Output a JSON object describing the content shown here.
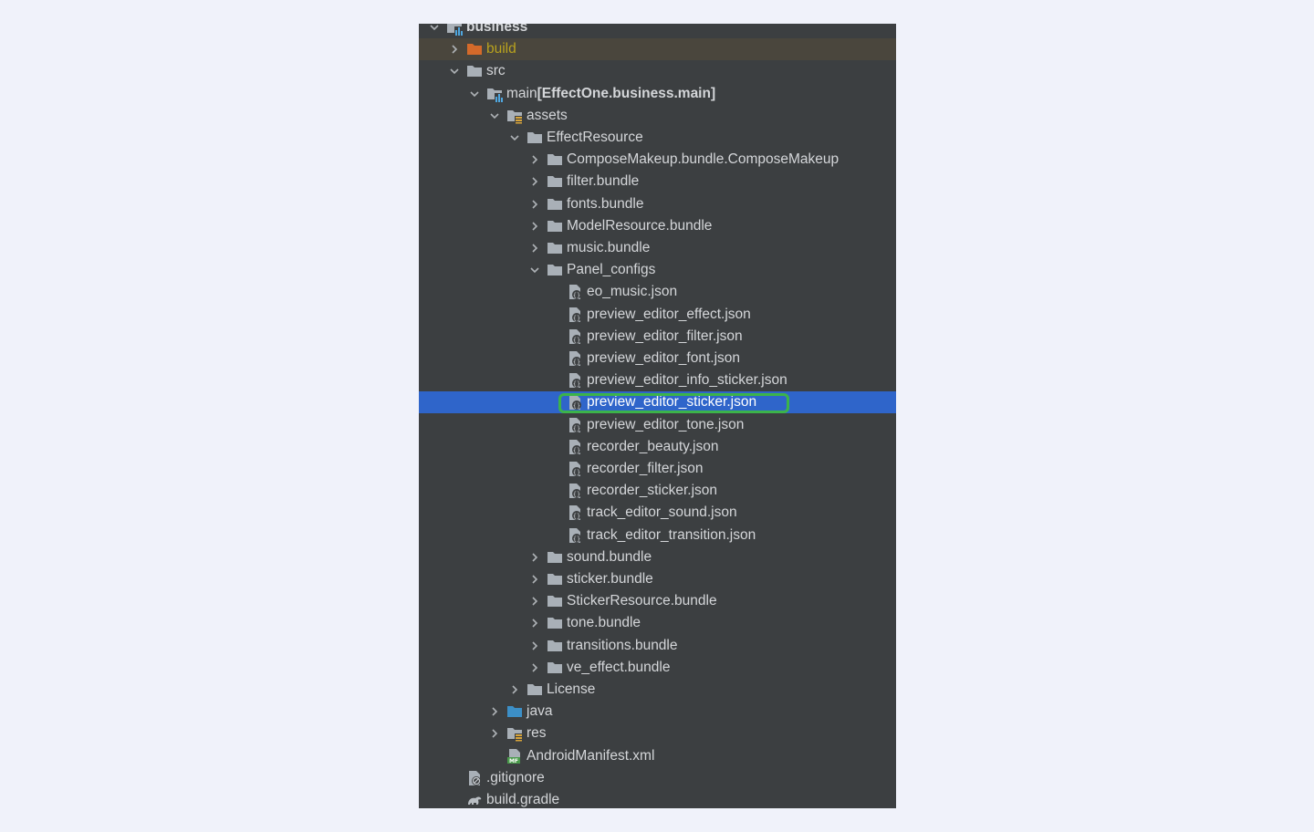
{
  "tree": {
    "nodes": [
      {
        "label": "business",
        "depth": 0,
        "expanded": true,
        "icon": "module-icon",
        "bold": true
      },
      {
        "label": "build",
        "depth": 1,
        "expanded": false,
        "icon": "folder-orange-icon",
        "style": "build"
      },
      {
        "label": "src",
        "depth": 1,
        "expanded": true,
        "icon": "folder-icon"
      },
      {
        "label": "main",
        "suffix": " [EffectOne.business.main]",
        "depth": 2,
        "expanded": true,
        "icon": "module-icon"
      },
      {
        "label": "assets",
        "depth": 3,
        "expanded": true,
        "icon": "resources-folder-icon"
      },
      {
        "label": "EffectResource",
        "depth": 4,
        "expanded": true,
        "icon": "folder-icon"
      },
      {
        "label": "ComposeMakeup.bundle.ComposeMakeup",
        "depth": 5,
        "expanded": false,
        "icon": "folder-icon"
      },
      {
        "label": "filter.bundle",
        "depth": 5,
        "expanded": false,
        "icon": "folder-icon"
      },
      {
        "label": "fonts.bundle",
        "depth": 5,
        "expanded": false,
        "icon": "folder-icon"
      },
      {
        "label": "ModelResource.bundle",
        "depth": 5,
        "expanded": false,
        "icon": "folder-icon"
      },
      {
        "label": "music.bundle",
        "depth": 5,
        "expanded": false,
        "icon": "folder-icon"
      },
      {
        "label": "Panel_configs",
        "depth": 5,
        "expanded": true,
        "icon": "folder-icon"
      },
      {
        "label": "eo_music.json",
        "depth": 6,
        "icon": "json-file-icon"
      },
      {
        "label": "preview_editor_effect.json",
        "depth": 6,
        "icon": "json-file-icon"
      },
      {
        "label": "preview_editor_filter.json",
        "depth": 6,
        "icon": "json-file-icon"
      },
      {
        "label": "preview_editor_font.json",
        "depth": 6,
        "icon": "json-file-icon"
      },
      {
        "label": "preview_editor_info_sticker.json",
        "depth": 6,
        "icon": "json-file-icon"
      },
      {
        "label": "preview_editor_sticker.json",
        "depth": 6,
        "icon": "json-file-icon",
        "selected": true
      },
      {
        "label": "preview_editor_tone.json",
        "depth": 6,
        "icon": "json-file-icon"
      },
      {
        "label": "recorder_beauty.json",
        "depth": 6,
        "icon": "json-file-icon"
      },
      {
        "label": "recorder_filter.json",
        "depth": 6,
        "icon": "json-file-icon"
      },
      {
        "label": "recorder_sticker.json",
        "depth": 6,
        "icon": "json-file-icon"
      },
      {
        "label": "track_editor_sound.json",
        "depth": 6,
        "icon": "json-file-icon"
      },
      {
        "label": "track_editor_transition.json",
        "depth": 6,
        "icon": "json-file-icon"
      },
      {
        "label": "sound.bundle",
        "depth": 5,
        "expanded": false,
        "icon": "folder-icon"
      },
      {
        "label": "sticker.bundle",
        "depth": 5,
        "expanded": false,
        "icon": "folder-icon"
      },
      {
        "label": "StickerResource.bundle",
        "depth": 5,
        "expanded": false,
        "icon": "folder-icon"
      },
      {
        "label": "tone.bundle",
        "depth": 5,
        "expanded": false,
        "icon": "folder-icon"
      },
      {
        "label": "transitions.bundle",
        "depth": 5,
        "expanded": false,
        "icon": "folder-icon"
      },
      {
        "label": "ve_effect.bundle",
        "depth": 5,
        "expanded": false,
        "icon": "folder-icon"
      },
      {
        "label": "License",
        "depth": 4,
        "expanded": false,
        "icon": "folder-icon"
      },
      {
        "label": "java",
        "depth": 3,
        "expanded": false,
        "icon": "source-folder-icon"
      },
      {
        "label": "res",
        "depth": 3,
        "expanded": false,
        "icon": "resources-folder-icon"
      },
      {
        "label": "AndroidManifest.xml",
        "depth": 3,
        "icon": "manifest-file-icon"
      },
      {
        "label": ".gitignore",
        "depth": 1,
        "icon": "gitignore-file-icon"
      },
      {
        "label": "build.gradle",
        "depth": 1,
        "icon": "gradle-file-icon"
      }
    ]
  },
  "colors": {
    "panel_bg": "#3c3f41",
    "selection": "#2f65ca",
    "excluded_bg": "#4a463d",
    "excluded_text": "#b9a21e",
    "highlight_box": "#3cb34a",
    "folder": "#a9b0b7",
    "folder_orange": "#d56a2a",
    "source_folder": "#3c8fc7"
  }
}
